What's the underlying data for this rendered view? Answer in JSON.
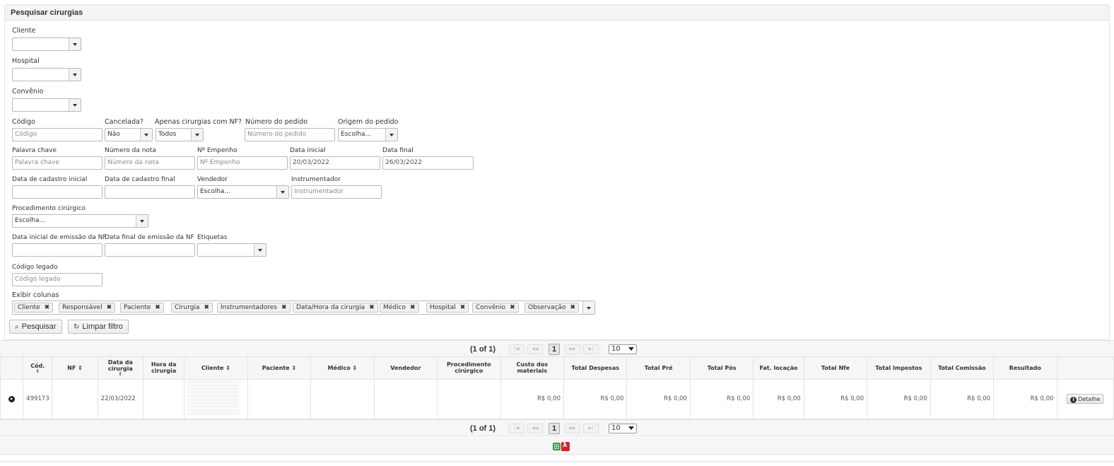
{
  "panel": {
    "title": "Pesquisar cirurgias"
  },
  "filters": {
    "cliente_label": "Cliente",
    "hospital_label": "Hospital",
    "convenio_label": "Convênio",
    "codigo_label": "Código",
    "codigo_placeholder": "Código",
    "cancelada_label": "Cancelada?",
    "cancelada_value": "Não",
    "apenas_nf_label": "Apenas cirurgias com NF?",
    "apenas_nf_value": "Todos",
    "numero_pedido_label": "Número do pedido",
    "numero_pedido_placeholder": "Número do pedido",
    "origem_pedido_label": "Origem do pedido",
    "origem_pedido_value": "Escolha...",
    "palavra_chave_label": "Palavra chave",
    "palavra_chave_placeholder": "Palavra chave",
    "numero_nota_label": "Número da nota",
    "numero_nota_placeholder": "Número da nota",
    "empenho_label": "Nº Empenho",
    "empenho_placeholder": "Nº Empenho",
    "data_inicial_label": "Data inicial",
    "data_inicial_value": "20/03/2022",
    "data_final_label": "Data final",
    "data_final_value": "26/03/2022",
    "cadastro_inicial_label": "Data de cadastro inicial",
    "cadastro_final_label": "Data de cadastro final",
    "vendedor_label": "Vendedor",
    "vendedor_value": "Escolha...",
    "instrumentador_label": "Instrumentador",
    "instrumentador_placeholder": "Instrumentador",
    "procedimento_label": "Procedimento cirúrgico",
    "procedimento_value": "Escolha...",
    "emissao_inicial_label": "Data inicial de emissão da NF",
    "emissao_final_label": "Data final de emissão da NF",
    "etiquetas_label": "Etiquetas",
    "codigo_legado_label": "Código legado",
    "codigo_legado_placeholder": "Código legado",
    "exibir_colunas_label": "Exibir colunas",
    "colunas": [
      "Cliente",
      "Responsável",
      "Paciente",
      "Cirurgia",
      "Instrumentadores",
      "Data/Hora da cirurgia",
      "Médico",
      "Hospital",
      "Convênio",
      "Observação"
    ],
    "chip_remove": "✖"
  },
  "actions": {
    "pesquisar": "Pesquisar",
    "limpar": "Limpar filtro"
  },
  "paginator": {
    "current": "(1 of 1)",
    "page": "1",
    "rows_per_page": "10"
  },
  "table": {
    "headers": {
      "cod": "Cód.",
      "nf": "NF",
      "data_cirurgia": "Data da cirurgia",
      "hora_cirurgia": "Hora da cirurgia",
      "cliente": "Cliente",
      "paciente": "Paciente",
      "medico": "Médico",
      "vendedor": "Vendedor",
      "procedimento": "Procedimento cirúrgico",
      "custo_materiais": "Custo dos materiais",
      "total_despesas": "Total Despesas",
      "total_pre": "Total Pré",
      "total_pos": "Total Pós",
      "fat_locacao": "Fat. locação",
      "total_nfe": "Total Nfe",
      "total_impostos": "Total Impostos",
      "total_comissao": "Total Comissão",
      "resultado": "Resultado"
    },
    "rows": [
      {
        "cod": "499173",
        "nf": "",
        "data_cirurgia": "22/03/2022",
        "hora_cirurgia": "",
        "paciente": "",
        "medico": "",
        "vendedor": "",
        "procedimento": "",
        "custo_materiais": "R$ 0,00",
        "total_despesas": "R$ 0,00",
        "total_pre": "R$ 0,00",
        "total_pos": "R$ 0,00",
        "fat_locacao": "R$ 0,00",
        "total_nfe": "R$ 0,00",
        "total_impostos": "R$ 0,00",
        "total_comissao": "R$ 0,00",
        "resultado": "R$ 0,00",
        "detalhe": "Detalhe"
      }
    ]
  },
  "icons": {
    "search": "magnifier-icon",
    "clear": "refresh-icon",
    "excel": "excel-icon",
    "pdf": "pdf-icon"
  },
  "colors": {
    "negative": "#e0383e"
  }
}
